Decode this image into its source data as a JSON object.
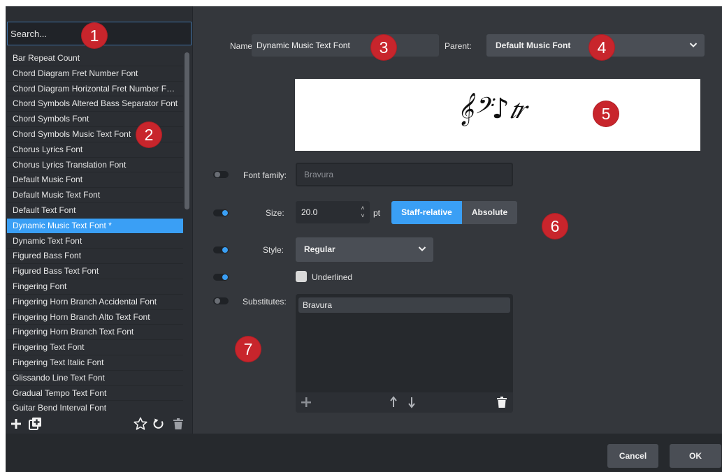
{
  "search": {
    "placeholder": "Search..."
  },
  "font_list": {
    "items": [
      "Bar Repeat Count",
      "Chord Diagram Fret Number Font",
      "Chord Diagram Horizontal Fret Number F…",
      "Chord Symbols Altered Bass Separator Font",
      "Chord Symbols Font",
      "Chord Symbols Music Text Font",
      "Chorus Lyrics Font",
      "Chorus Lyrics Translation Font",
      "Default Music Font",
      "Default Music Text Font",
      "Default Text Font",
      "Dynamic Music Text Font *",
      "Dynamic Text Font",
      "Figured Bass Font",
      "Figured Bass Text Font",
      "Fingering Font",
      "Fingering Horn Branch Accidental Font",
      "Fingering Horn Branch Alto Text Font",
      "Fingering Horn Branch Text Font",
      "Fingering Text Font",
      "Fingering Text Italic Font",
      "Glissando Line Text Font",
      "Gradual Tempo Text Font",
      "Guitar Bend Interval Font"
    ],
    "selected_index": 11,
    "scroll_fraction": 0.43
  },
  "list_toolbar": {
    "icons": [
      "plus-icon",
      "duplicate-icon",
      "star-icon",
      "reset-icon",
      "trash-icon"
    ]
  },
  "editor": {
    "name_label": "Name:",
    "name_value": "Dynamic Music Text Font",
    "parent_label": "Parent:",
    "parent_value": "Default Music Font",
    "font_family_label": "Font family:",
    "font_family_value": "Bravura",
    "font_family_enabled": false,
    "size_label": "Size:",
    "size_value": "20.0",
    "size_unit": "pt",
    "size_enabled": true,
    "size_mode_options": [
      "Staff-relative",
      "Absolute"
    ],
    "size_mode_selected": "Staff-relative",
    "style_label": "Style:",
    "style_value": "Regular",
    "style_enabled": true,
    "underline_enabled": true,
    "underline_label": "Underlined",
    "underline_checked": false,
    "substitutes_label": "Substitutes:",
    "substitutes_enabled": false,
    "substitutes": [
      "Bravura"
    ]
  },
  "preview": {
    "glyphs": "𝄞𝄢♪𝆖"
  },
  "callouts": [
    "1",
    "2",
    "3",
    "4",
    "5",
    "6",
    "7"
  ],
  "footer": {
    "cancel_label": "Cancel",
    "ok_label": "OK"
  },
  "colors": {
    "accent": "#3a9ff5",
    "callout": "#c8252c",
    "panel": "#34373c"
  }
}
